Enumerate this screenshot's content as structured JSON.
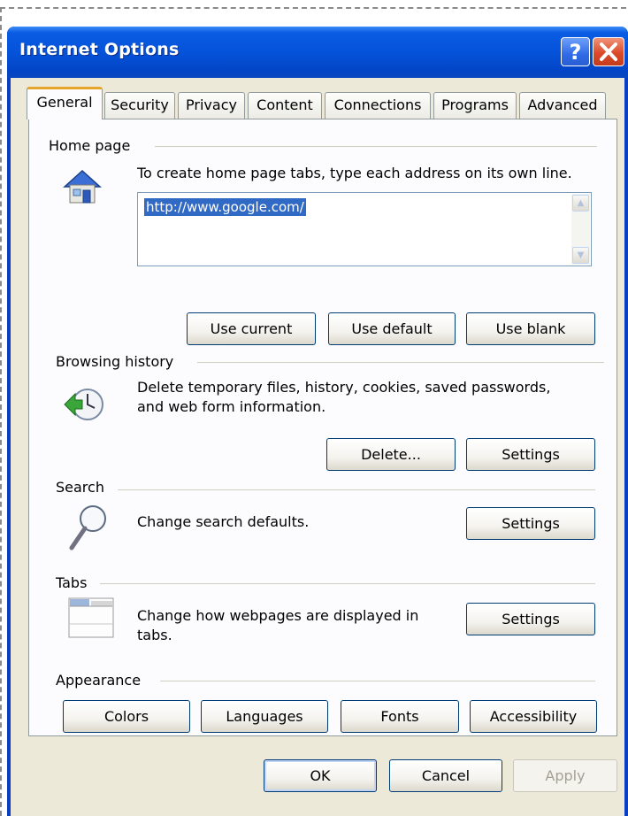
{
  "window": {
    "title": "Internet Options"
  },
  "titlebar": {
    "help_label": "?",
    "close_label": "✕"
  },
  "tabs": [
    {
      "label": "General"
    },
    {
      "label": "Security"
    },
    {
      "label": "Privacy"
    },
    {
      "label": "Content"
    },
    {
      "label": "Connections"
    },
    {
      "label": "Programs"
    },
    {
      "label": "Advanced"
    }
  ],
  "home_page": {
    "heading": "Home page",
    "description": "To create home page tabs, type each address on its own line.",
    "url": "http://www.google.com/",
    "buttons": {
      "use_current": "Use current",
      "use_default": "Use default",
      "use_blank": "Use blank"
    }
  },
  "browsing_history": {
    "heading": "Browsing history",
    "description_line1": "Delete temporary files, history, cookies, saved passwords,",
    "description_line2": "and web form information.",
    "buttons": {
      "delete": "Delete...",
      "settings": "Settings"
    }
  },
  "search": {
    "heading": "Search",
    "description": "Change search defaults.",
    "settings_label": "Settings"
  },
  "tabs_section": {
    "heading": "Tabs",
    "description_line1": "Change how webpages are displayed in",
    "description_line2": "tabs.",
    "settings_label": "Settings"
  },
  "appearance": {
    "heading": "Appearance",
    "buttons": {
      "colors": "Colors",
      "languages": "Languages",
      "fonts": "Fonts",
      "accessibility": "Accessibility"
    }
  },
  "footer": {
    "ok": "OK",
    "cancel": "Cancel",
    "apply": "Apply"
  },
  "colors": {
    "titlebar": "#0553da",
    "client_bg": "#ece9d8",
    "panel_bg": "#fcfcfe",
    "tab_highlight": "#e6a52a",
    "selection": "#316ac5"
  }
}
